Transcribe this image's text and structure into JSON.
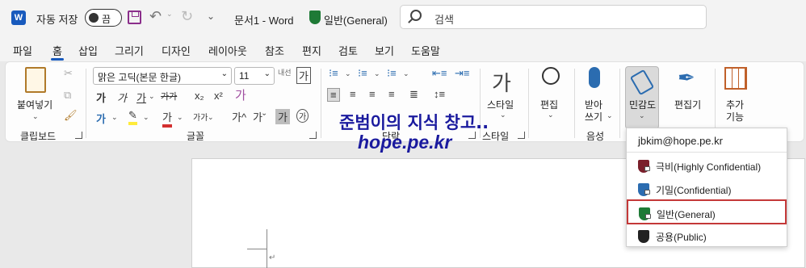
{
  "titlebar": {
    "app_logo": "W",
    "autosave_label": "자동 저장",
    "autosave_state": "끔",
    "doc_title": "문서1 - Word",
    "sensitivity_label": "일반(General)",
    "search_placeholder": "검색"
  },
  "tabs": [
    "파일",
    "홈",
    "삽입",
    "그리기",
    "디자인",
    "레이아웃",
    "참조",
    "편지",
    "검토",
    "보기",
    "도움말"
  ],
  "active_tab": "홈",
  "ribbon": {
    "clipboard": {
      "paste_label": "붙여넣기",
      "group_label": "클립보드"
    },
    "font": {
      "font_name": "맑은 고딕(본문 한글)",
      "font_size": "11",
      "hangul_btn": "내선",
      "ga_btn": "가",
      "row2": [
        "가",
        "가",
        "가",
        "가가",
        "x₂",
        "x²"
      ],
      "row3": [
        "가",
        "가",
        "가가",
        "가",
        "가"
      ],
      "grow": "가^",
      "shrink": "가ˇ",
      "group_label": "글꼴"
    },
    "paragraph": {
      "group_label": "단락"
    },
    "styles": {
      "label": "스타일",
      "group_label": "스타일"
    },
    "editing": {
      "label": "편집"
    },
    "dictate": {
      "label_line1": "받아",
      "label_line2": "쓰기",
      "group_label": "음성"
    },
    "sensitivity": {
      "label": "민감도"
    },
    "editor": {
      "label": "편집기"
    },
    "addins": {
      "label_line1": "추가",
      "label_line2": "기능"
    }
  },
  "watermark": {
    "line1": "준범이의 지식 창고..",
    "line2": "hope.pe.kr"
  },
  "dropdown": {
    "account": "jbkim@hope.pe.kr",
    "items": [
      {
        "label": "극비(Highly Confidential)",
        "color": "#7a1f2b"
      },
      {
        "label": "기밀(Confidential)",
        "color": "#2b6cb0"
      },
      {
        "label": "일반(General)",
        "color": "#1e7a36"
      },
      {
        "label": "공용(Public)",
        "color": "#222222"
      }
    ],
    "selected_index": 2
  },
  "colors": {
    "accent": "#185abd",
    "highlight_border": "#c43838",
    "watermark": "#1a1a9e"
  }
}
